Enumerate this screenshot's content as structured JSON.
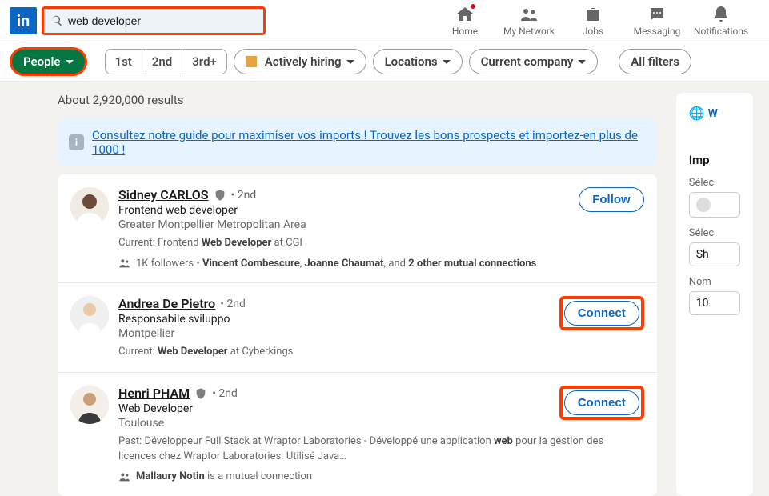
{
  "search": {
    "value": "web developer"
  },
  "nav": {
    "home": "Home",
    "network": "My Network",
    "jobs": "Jobs",
    "messaging": "Messaging",
    "notifications": "Notifications"
  },
  "filters": {
    "people": "People",
    "conn1": "1st",
    "conn2": "2nd",
    "conn3": "3rd+",
    "hiring": "Actively hiring",
    "locations": "Locations",
    "company": "Current company",
    "all": "All filters"
  },
  "results_count": "About 2,920,000 results",
  "infobar": {
    "text": "Consultez notre guide pour maximiser vos imports ! Trouvez les bons prospects et importez-en plus de 1000 !"
  },
  "results": [
    {
      "name": "Sidney CARLOS",
      "verified": true,
      "degree": "2nd",
      "headline": "Frontend web developer",
      "location": "Greater Montpellier Metropolitan Area",
      "current_prefix": "Current: Frontend ",
      "current_bold": "Web Developer",
      "current_suffix": " at CGI",
      "mutual_pre": "1K followers • ",
      "mutual_bold1": "Vincent Combescure",
      "mutual_mid": ", ",
      "mutual_bold2": "Joanne Chaumat",
      "mutual_post": ", and ",
      "mutual_bold3": "2 other mutual connections",
      "action": "Follow",
      "highlight": false
    },
    {
      "name": "Andrea De Pietro",
      "verified": false,
      "degree": "2nd",
      "headline": "Responsabile sviluppo",
      "location": "Montpellier",
      "current_prefix": "Current: ",
      "current_bold": "Web Developer",
      "current_suffix": " at Cyberkings",
      "action": "Connect",
      "highlight": true
    },
    {
      "name": "Henri PHAM",
      "verified": true,
      "degree": "2nd",
      "headline": "Web Developer",
      "location": "Toulouse",
      "past_pre": "Past: Développeur Full Stack at Wraptor Laboratories - Développé une application ",
      "past_bold": "web",
      "past_post": " pour la gestion des licences chez Wraptor Laboratories. Utilisé Java…",
      "mutual_bold1": "Mallaury Notin",
      "mutual_post": " is a mutual connection",
      "action": "Connect",
      "highlight": true
    }
  ],
  "sidebar": {
    "w": "W",
    "imp": "Imp",
    "selec": "Sélec",
    "sh": "Sh",
    "nom": "Nom",
    "ten": "10"
  }
}
